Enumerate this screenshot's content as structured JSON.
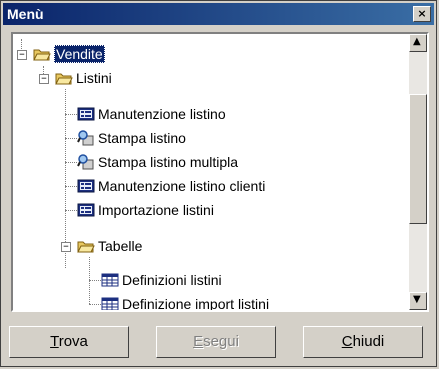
{
  "window": {
    "title": "Menù",
    "close_glyph": "×"
  },
  "tree": {
    "nodes": [
      {
        "label": "Vendite",
        "icon": "folder-open-icon",
        "expander": "−",
        "selected": true
      },
      {
        "label": "Listini",
        "icon": "folder-open-icon",
        "expander": "−"
      },
      {
        "label": "Manutenzione listino",
        "icon": "form-icon"
      },
      {
        "label": "Stampa listino",
        "icon": "print-search-icon"
      },
      {
        "label": "Stampa listino multipla",
        "icon": "print-search-icon"
      },
      {
        "label": "Manutenzione listino clienti",
        "icon": "form-icon"
      },
      {
        "label": "Importazione listini",
        "icon": "form-icon"
      },
      {
        "label": "Tabelle",
        "icon": "folder-open-icon",
        "expander": "−"
      },
      {
        "label": "Definizioni listini",
        "icon": "table-icon"
      },
      {
        "label": "Definizione import listini",
        "icon": "table-icon"
      }
    ]
  },
  "scrollbar": {
    "up_glyph": "▲",
    "down_glyph": "▼"
  },
  "buttons": {
    "trova": {
      "accel": "T",
      "rest": "rova",
      "enabled": true
    },
    "esegui": {
      "accel": "E",
      "rest": "segui",
      "enabled": false
    },
    "chiudi": {
      "accel": "C",
      "rest": "hiudi",
      "enabled": true
    }
  },
  "colors": {
    "title_bar": "#0a246a",
    "face": "#d4d0c8",
    "selection": "#0a246a"
  }
}
